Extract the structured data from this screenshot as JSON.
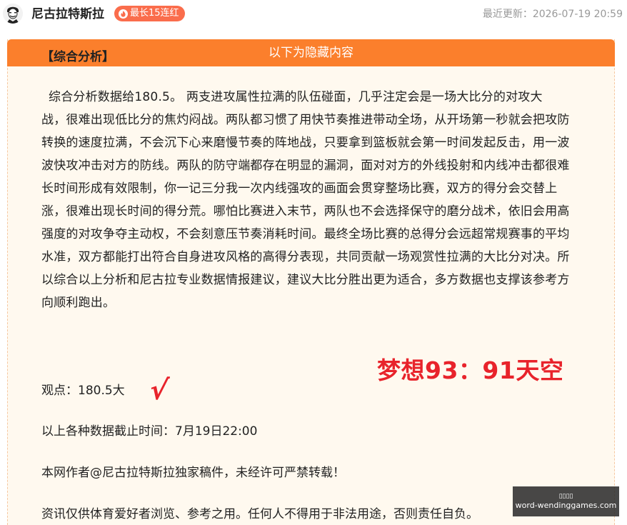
{
  "header": {
    "author_name": "尼古拉特斯拉",
    "streak_badge": "最长15连红",
    "update_label": "最近更新：",
    "update_time": "2026-07-19 20:59"
  },
  "card": {
    "title": "以下为隐藏内容",
    "section_heading": "【综合分析】",
    "analysis_lines": [
      "综合分析数据给180.5。 两支进攻属性拉满的队伍碰面，几乎注定会是一场大比分的对攻大",
      "战，很难出现低比分的焦灼闷战。两队都习惯了用快节奏推进带动全场，从开场第一秒就会把攻防",
      "转换的速度拉满，不会沉下心来磨慢节奏的阵地战，只要拿到篮板就会第一时间发起反击，用一波",
      "波快攻冲击对方的防线。两队的防守端都存在明显的漏洞，面对对方的外线投射和内线冲击都很难",
      "长时间形成有效限制，你一记三分我一次内线强攻的画面会贯穿整场比赛，双方的得分会交替上",
      "涨，很难出现长时间的得分荒。哪怕比赛进入末节，两队也不会选择保守的磨分战术，依旧会用高",
      "强度的对攻争夺主动权，不会刻意压节奏消耗时间。最终全场比赛的总得分会远超常规赛事的平均",
      "水准，双方都能打出符合自身进攻风格的高得分表现，共同贡献一场观赏性拉满的大比分对决。所",
      "以综合以上分析和尼古拉专业数据情报建议，建议大比分胜出更为适合，多方数据也支撑该参考方",
      "向顺利跑出。"
    ],
    "viewpoint": "观点：180.5大",
    "check_mark": "√",
    "dream_score": "梦想93：91天空",
    "cutoff": "以上各种数据截止时间：7月19日22:00",
    "copyright": "本网作者@尼古拉特斯拉独家稿件，未经许可严禁转载！",
    "disclaimer": "资讯仅供体育爱好者浏览、参考之用。任何人不得用于非法用途，否则责任自负。"
  },
  "watermark": {
    "top": "▯▯▯▯",
    "bottom": "word-wendinggames.com"
  },
  "colors": {
    "accent_orange": "#fb7f2c",
    "badge": "#fa6d4c",
    "card_bg": "#fff9ef",
    "red": "#e8232b"
  }
}
